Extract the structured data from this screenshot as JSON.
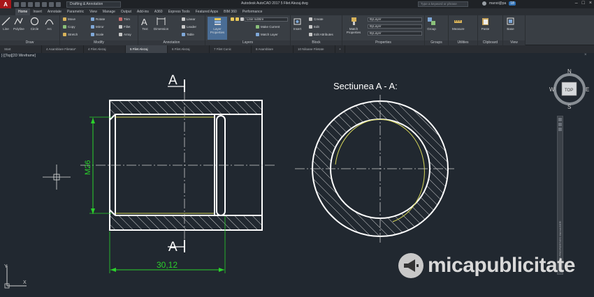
{
  "titlebar": {
    "logo": "A",
    "workspace": "Drafting & Annotation",
    "app_title": "Autodesk AutoCAD 2017   5 Filet Alezaj.dwg",
    "search_placeholder": "Type a keyword or phrase",
    "username": "manoi@pa",
    "notifications": "18"
  },
  "ribbon_tabs": [
    "Home",
    "Insert",
    "Annotate",
    "Parametric",
    "View",
    "Manage",
    "Output",
    "Add-ins",
    "A360",
    "Express Tools",
    "Featured Apps",
    "BIM 360",
    "Performance"
  ],
  "ribbon": {
    "draw": {
      "label": "Draw",
      "line": "Line",
      "polyline": "Polyline",
      "circle": "Circle",
      "arc": "Arc"
    },
    "modify": {
      "label": "Modify",
      "move": "Move",
      "rotate": "Rotate",
      "trim": "Trim",
      "copy": "Copy",
      "mirror": "Mirror",
      "fillet": "Fillet",
      "stretch": "Stretch",
      "scale": "Scale",
      "array": "Array"
    },
    "annotation": {
      "label": "Annotation",
      "text": "Text",
      "dimension": "Dimension",
      "linear": "Linear",
      "leader": "Leader",
      "table": "Table"
    },
    "layers": {
      "label": "Layers",
      "properties": "Layer Properties",
      "current_layer": "Linie subtire",
      "make_current": "Make Current",
      "match_layer": "Match Layer"
    },
    "block": {
      "label": "Block",
      "insert": "Insert",
      "create": "Create",
      "edit": "Edit",
      "edit_attributes": "Edit Attributes"
    },
    "properties": {
      "label": "Properties",
      "match": "Match Properties",
      "color": "ByLayer",
      "linetype": "ByLayer",
      "lineweight": "ByLayer"
    },
    "groups": {
      "label": "Groups",
      "group": "Group"
    },
    "utilities": {
      "label": "Utilities",
      "measure": "Measure"
    },
    "clipboard": {
      "label": "Clipboard",
      "paste": "Paste"
    },
    "view": {
      "label": "View",
      "base": "Base"
    }
  },
  "doc_tabs": [
    "Start",
    "4 Asamblare Filetata*",
    "4 Filet Alezaj",
    "5 Filet Alezaj",
    "6 Filet Alezaj",
    "7 Filet Cunic",
    "8 Asamblare",
    "10 Niloane Filetate"
  ],
  "active_doc_tab": 3,
  "viewport": {
    "label": "[-][Top][2D Wireframe]"
  },
  "drawing": {
    "section_mark": "A",
    "section_title": "Sectiunea A - A:",
    "dim_diameter": "M26",
    "dim_length": "30,12"
  },
  "viewcube": {
    "top": "TOP",
    "n": "N",
    "s": "S",
    "e": "E",
    "w": "W"
  },
  "navbar_label": "LAYER PROPERTIES MANAGER",
  "ucs": {
    "y": "Y",
    "x": "X"
  },
  "watermark": "micapublicitate",
  "colors": {
    "accent": "#a8171a",
    "drawing_line": "#ffffff",
    "dimension": "#2bd12b",
    "thread": "#d8d85a",
    "background": "#212830"
  }
}
